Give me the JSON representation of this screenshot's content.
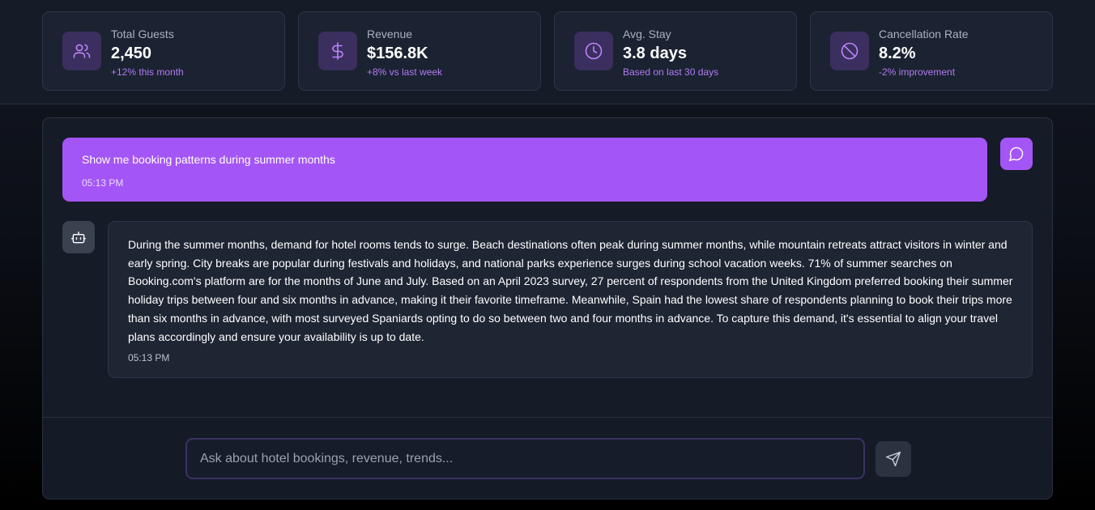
{
  "stats": [
    {
      "label": "Total Guests",
      "value": "2,450",
      "sub": "+12% this month",
      "icon": "users-icon"
    },
    {
      "label": "Revenue",
      "value": "$156.8K",
      "sub": "+8% vs last week",
      "icon": "dollar-icon"
    },
    {
      "label": "Avg. Stay",
      "value": "3.8 days",
      "sub": "Based on last 30 days",
      "icon": "clock-icon"
    },
    {
      "label": "Cancellation Rate",
      "value": "8.2%",
      "sub": "-2% improvement",
      "icon": "ban-icon"
    }
  ],
  "chat": {
    "user_message": {
      "text": "Show me booking patterns during summer months",
      "time": "05:13 PM"
    },
    "bot_message": {
      "text": "During the summer months, demand for hotel rooms tends to surge. Beach destinations often peak during summer months, while mountain retreats attract visitors in winter and early spring. City breaks are popular during festivals and holidays, and national parks experience surges during school vacation weeks. 71% of summer searches on Booking.com's platform are for the months of June and July. Based on an April 2023 survey, 27 percent of respondents from the United Kingdom preferred booking their summer holiday trips between four and six months in advance, making it their favorite timeframe. Meanwhile, Spain had the lowest share of respondents planning to book their trips more than six months in advance, with most surveyed Spaniards opting to do so between two and four months in advance. To capture this demand, it's essential to align your travel plans accordingly and ensure your availability is up to date.",
      "time": "05:13 PM"
    }
  },
  "input": {
    "placeholder": "Ask about hotel bookings, revenue, trends...",
    "value": ""
  },
  "icons": {
    "user_avatar": "message-circle-icon",
    "bot_avatar": "bot-icon",
    "send": "send-icon"
  },
  "colors": {
    "accent": "#a855f7",
    "icon_bg": "#3a2f5e",
    "icon_stroke": "#c084fc",
    "sub_text": "#b07cf4"
  }
}
